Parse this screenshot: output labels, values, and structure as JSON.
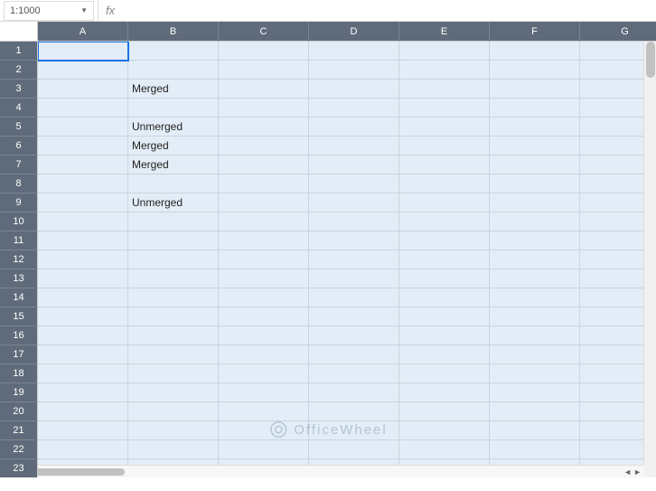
{
  "formula_bar": {
    "name_box_value": "1:1000",
    "fx_label": "fx",
    "formula_value": ""
  },
  "columns": [
    "A",
    "B",
    "C",
    "D",
    "E",
    "F",
    "G"
  ],
  "rows": [
    "1",
    "2",
    "3",
    "4",
    "5",
    "6",
    "7",
    "8",
    "9",
    "10",
    "11",
    "12",
    "13",
    "14",
    "15",
    "16",
    "17",
    "18",
    "19",
    "20",
    "21",
    "22",
    "23"
  ],
  "cell_values": {
    "B3": "Merged",
    "B5": "Unmerged",
    "B6": "Merged",
    "B7": "Merged",
    "B9": "Unmerged"
  },
  "active_cell": "A1",
  "watermark_text": "OfficeWheel",
  "chart_data": {
    "type": "table",
    "title": "",
    "columns": [
      "A",
      "B",
      "C",
      "D",
      "E",
      "F",
      "G"
    ],
    "rows": [
      {
        "row": 3,
        "B": "Merged"
      },
      {
        "row": 5,
        "B": "Unmerged"
      },
      {
        "row": 6,
        "B": "Merged"
      },
      {
        "row": 7,
        "B": "Merged"
      },
      {
        "row": 9,
        "B": "Unmerged"
      }
    ]
  }
}
